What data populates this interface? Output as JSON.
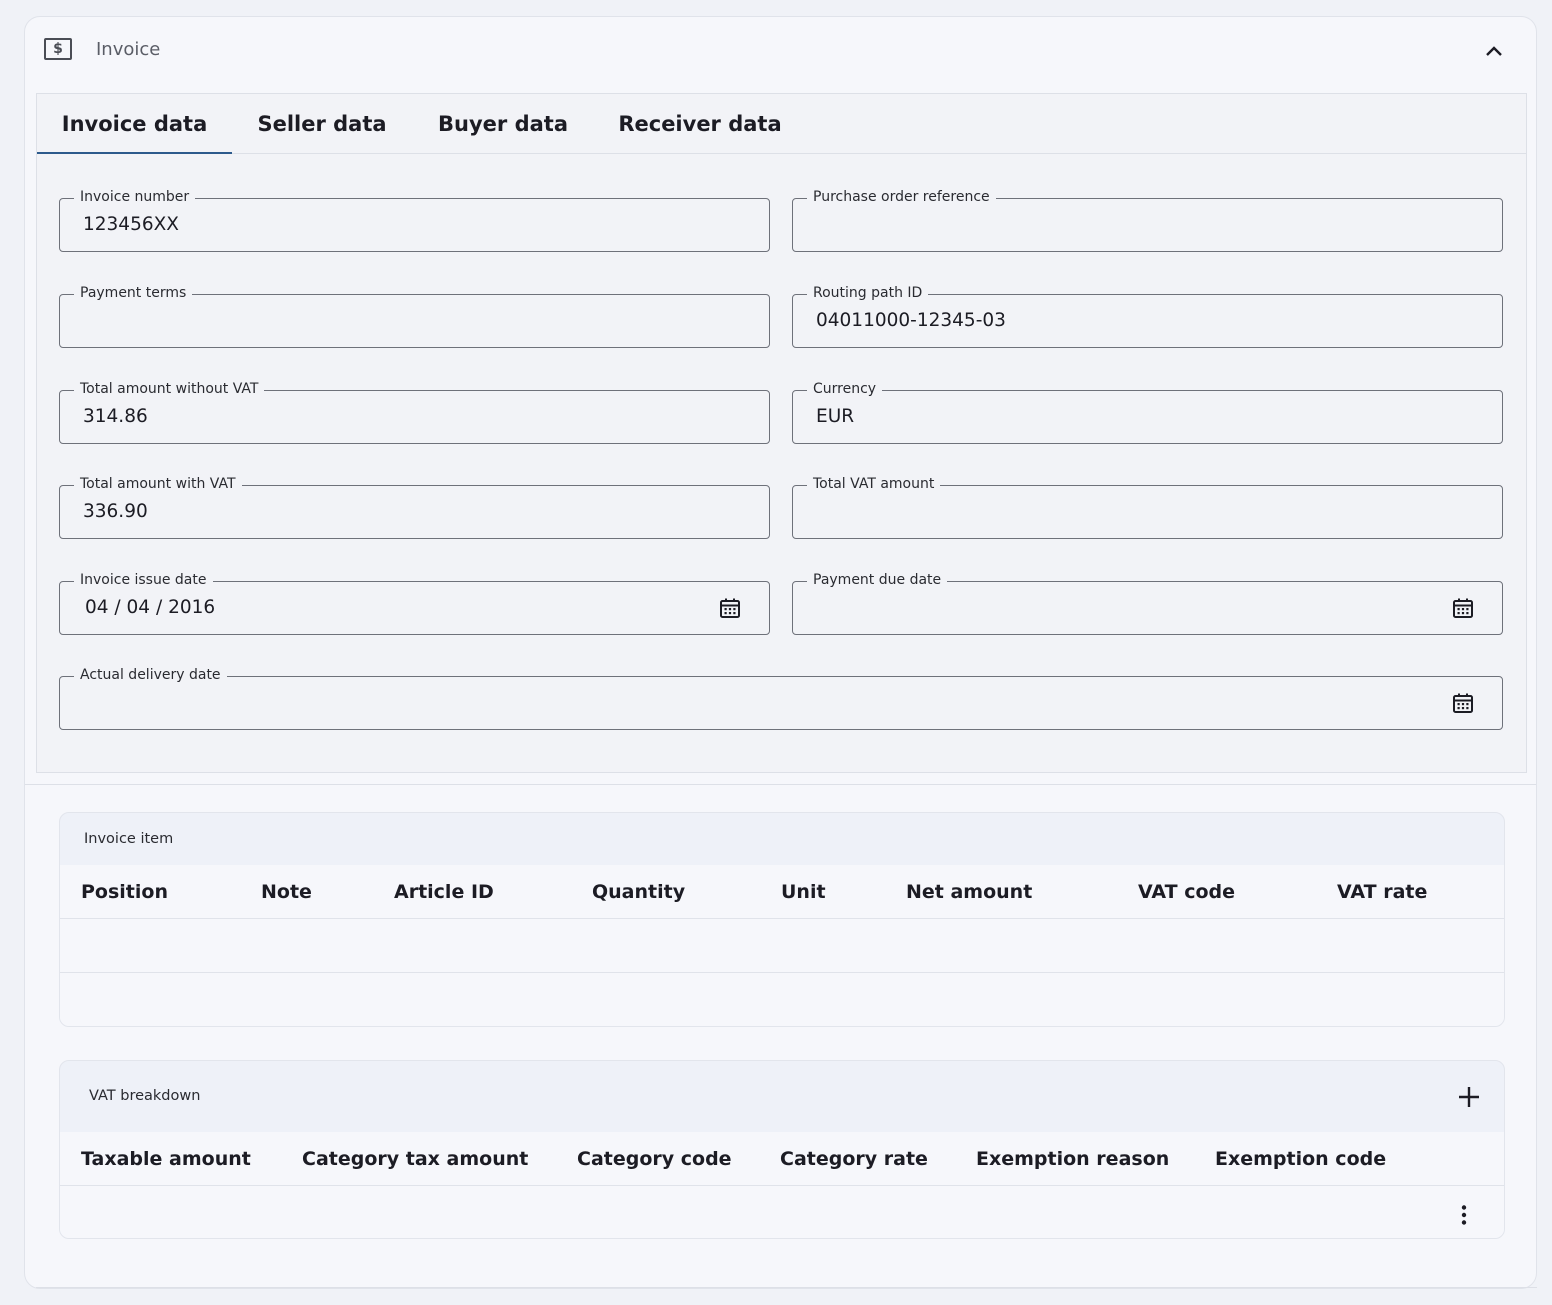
{
  "header": {
    "title": "Invoice",
    "icon": "money-icon"
  },
  "tabs": [
    {
      "label": "Invoice data",
      "active": true
    },
    {
      "label": "Seller data",
      "active": false
    },
    {
      "label": "Buyer data",
      "active": false
    },
    {
      "label": "Receiver data",
      "active": false
    }
  ],
  "fields": {
    "invoice_number": {
      "label": "Invoice number",
      "value": "123456XX"
    },
    "purchase_order_reference": {
      "label": "Purchase order reference",
      "value": ""
    },
    "payment_terms": {
      "label": "Payment terms",
      "value": ""
    },
    "routing_path_id": {
      "label": "Routing path ID",
      "value": "04011000-12345-03"
    },
    "total_without_vat": {
      "label": "Total amount without VAT",
      "value": "314.86"
    },
    "currency": {
      "label": "Currency",
      "value": "EUR"
    },
    "total_with_vat": {
      "label": "Total amount with VAT",
      "value": "336.90"
    },
    "total_vat_amount": {
      "label": "Total VAT amount",
      "value": ""
    },
    "invoice_issue_date": {
      "label": "Invoice issue date",
      "value": "04 / 04 / 2016"
    },
    "payment_due_date": {
      "label": "Payment due date",
      "value": ""
    },
    "actual_delivery_date": {
      "label": "Actual delivery date",
      "value": ""
    }
  },
  "invoice_item": {
    "title": "Invoice item",
    "columns": [
      "Position",
      "Note",
      "Article ID",
      "Quantity",
      "Unit",
      "Net amount",
      "VAT code",
      "VAT rate"
    ]
  },
  "vat_breakdown": {
    "title": "VAT breakdown",
    "columns": [
      "Taxable amount",
      "Category tax amount",
      "Category code",
      "Category rate",
      "Exemption reason",
      "Exemption code"
    ]
  },
  "colors": {
    "tab_indicator": "#2d5a8c",
    "background": "#f0f2f7"
  }
}
